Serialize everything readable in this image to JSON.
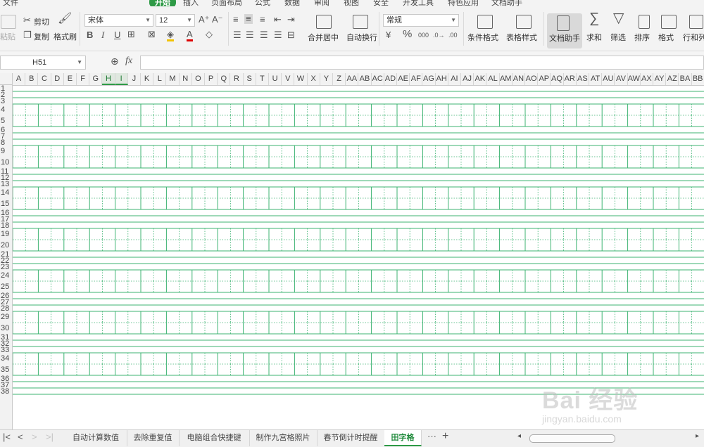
{
  "menubar": {
    "items": [
      "文件",
      "开始",
      "插入",
      "页面布局",
      "公式",
      "数据",
      "审阅",
      "视图",
      "安全",
      "开发工具",
      "特色应用",
      "文档助手"
    ]
  },
  "ribbon": {
    "paste": "粘贴",
    "cut": "剪切",
    "copy": "复制",
    "format_painter": "格式刷",
    "font_name": "宋体",
    "font_size": "12",
    "bold": "B",
    "italic": "I",
    "underline": "U",
    "font_color": "A",
    "merge_center": "合并居中",
    "wrap_text": "自动换行",
    "number_format": "常规",
    "conditional_format": "条件格式",
    "table_style": "表格样式",
    "doc_helper": "文档助手",
    "sum": "求和",
    "filter": "筛选",
    "sort": "排序",
    "format": "格式",
    "row_col": "行和列"
  },
  "formula": {
    "name_box": "H51",
    "fx": "fx"
  },
  "columns": [
    "A",
    "B",
    "C",
    "D",
    "E",
    "F",
    "G",
    "H",
    "I",
    "J",
    "K",
    "L",
    "M",
    "N",
    "O",
    "P",
    "Q",
    "R",
    "S",
    "T",
    "U",
    "V",
    "W",
    "X",
    "Y",
    "Z",
    "AA",
    "AB",
    "AC",
    "AD",
    "AE",
    "AF",
    "AG",
    "AH",
    "AI",
    "AJ",
    "AK",
    "AL",
    "AM",
    "AN",
    "AO",
    "AP",
    "AQ",
    "AR",
    "AS",
    "AT",
    "AU",
    "AV",
    "AW",
    "AX",
    "AY",
    "AZ",
    "BA",
    "BB"
  ],
  "selected_columns": [
    "H",
    "I"
  ],
  "rows": [
    "1",
    "2",
    "3",
    "4",
    "5",
    "6",
    "7",
    "8",
    "9",
    "10",
    "11",
    "12",
    "13",
    "14",
    "15",
    "16",
    "17",
    "18",
    "19",
    "20",
    "21",
    "22",
    "23",
    "24",
    "25",
    "26",
    "27",
    "28",
    "29",
    "30",
    "31",
    "32",
    "33",
    "34",
    "35",
    "36",
    "37",
    "38"
  ],
  "sheets": {
    "tabs": [
      "自动计算数值",
      "去除重复值",
      "电脑组合快捷键",
      "制作九宫格照片",
      "春节倒计时提醒",
      "田字格"
    ],
    "active": "田字格",
    "more": "···",
    "add": "+"
  },
  "watermark": {
    "text": "Bai 经验",
    "url": "jingyan.baidu.com"
  },
  "colors": {
    "accent": "#2e9a46",
    "grid_line": "#3cb371"
  }
}
